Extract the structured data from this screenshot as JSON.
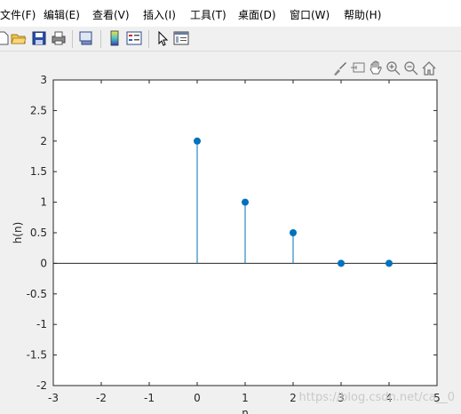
{
  "menu": {
    "items": [
      "文件(F)",
      "编辑(E)",
      "查看(V)",
      "插入(I)",
      "工具(T)",
      "桌面(D)",
      "窗口(W)",
      "帮助(H)"
    ]
  },
  "toolbar": {
    "icons": [
      "new-figure-icon",
      "open-folder-icon",
      "save-icon",
      "print-icon",
      "print-preview-icon",
      "colorbar-icon",
      "legend-icon",
      "pointer-icon",
      "property-editor-icon"
    ]
  },
  "axes_toolbar": {
    "icons": [
      "brush-icon",
      "data-tips-icon",
      "pan-icon",
      "zoom-in-icon",
      "zoom-out-icon",
      "home-icon"
    ]
  },
  "watermark": "https://blog.csdn.net/ca__0",
  "chart_data": {
    "type": "stem",
    "x": [
      0,
      1,
      2,
      3,
      4
    ],
    "y": [
      2,
      1,
      0.5,
      0,
      0
    ],
    "xlim": [
      -3,
      5
    ],
    "ylim": [
      -2,
      3
    ],
    "xticks": [
      -3,
      -2,
      -1,
      0,
      1,
      2,
      3,
      4,
      5
    ],
    "yticks": [
      -2,
      -1.5,
      -1,
      -0.5,
      0,
      0.5,
      1,
      1.5,
      2,
      2.5,
      3
    ],
    "xlabel": "n",
    "ylabel": "h(n)",
    "baseline": 0,
    "grid": false,
    "color": "#0072bd"
  }
}
